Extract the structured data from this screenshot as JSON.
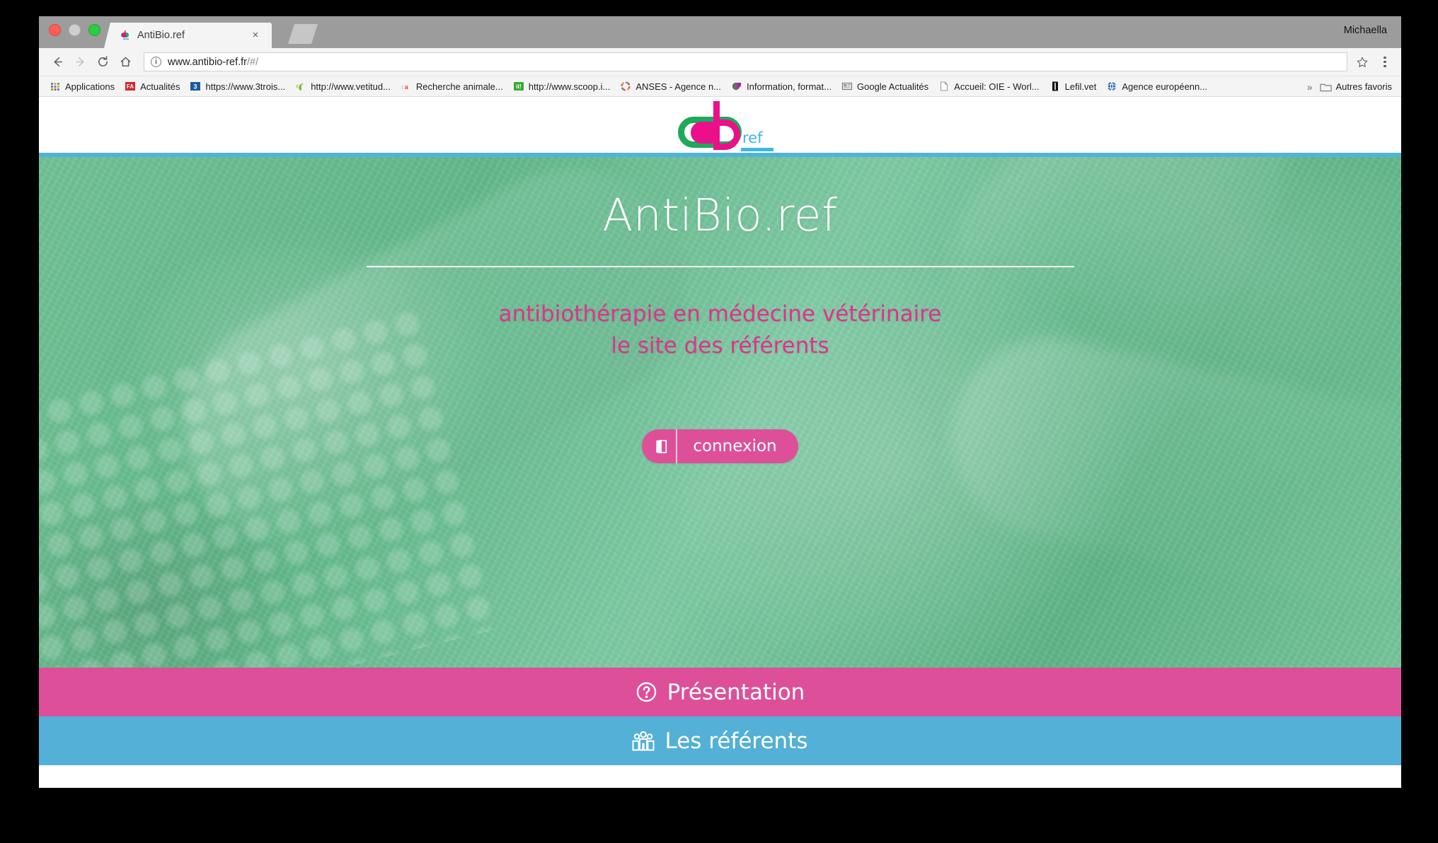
{
  "os": {
    "user_name": "Michaella"
  },
  "browser": {
    "tab": {
      "title": "AntiBio.ref",
      "close_label": "×"
    },
    "toolbar": {
      "back_label": "←",
      "forward_label": "→",
      "reload_label": "⟳",
      "home_label": "⌂",
      "info_label": "i",
      "url_main": "www.antibio-ref.fr",
      "url_path": "/#/",
      "star_label": "☆"
    },
    "bookmarks": {
      "items": [
        {
          "label": "Applications",
          "icon": "apps-grid-icon",
          "color": "#4a90d9"
        },
        {
          "label": "Actualités",
          "icon": "fa-icon",
          "color": "#d8232a"
        },
        {
          "label": "https://www.3trois...",
          "icon": "three-icon",
          "color": "#1b5c9b"
        },
        {
          "label": "http://www.vetitud...",
          "icon": "leaf-icon",
          "color": "#8cc63e"
        },
        {
          "label": "Recherche animale...",
          "icon": "ra-icon",
          "color": "#e8502a"
        },
        {
          "label": "http://www.scoop.i...",
          "icon": "scoopit-icon",
          "color": "#3aa935"
        },
        {
          "label": "ANSES - Agence n...",
          "icon": "anses-ring-icon",
          "color": "#e94e8a"
        },
        {
          "label": "Information, format...",
          "icon": "info-format-icon",
          "color": "#7a1fa2"
        },
        {
          "label": "Google Actualités",
          "icon": "news-icon",
          "color": "#7a7a7a"
        },
        {
          "label": "Accueil: OIE - Worl...",
          "icon": "page-icon",
          "color": "#9a9a9a"
        },
        {
          "label": "Lefil.vet",
          "icon": "lefil-icon",
          "color": "#111111"
        },
        {
          "label": "Agence européenn...",
          "icon": "globe-icon",
          "color": "#2d6fb5"
        }
      ],
      "overflow_label": "»",
      "other_bookmarks_label": "Autres favoris"
    }
  },
  "site": {
    "logo": {
      "ref_text": "ref",
      "green": "#1eaa5a",
      "pink": "#ec0f8c",
      "blue": "#3fb6e5"
    },
    "hero": {
      "title": "AntiBio.ref",
      "subtitle_line1": "antibiothérapie en médecine vétérinaire",
      "subtitle_line2": "le site des référents",
      "login_label": "connexion",
      "title_color": "#ffffff",
      "subtitle_color": "#e0338c",
      "button_color": "#dd5099"
    },
    "nav": [
      {
        "label": "Présentation",
        "icon": "question-circle-icon",
        "color": "#dd5099"
      },
      {
        "label": "Les référents",
        "icon": "people-group-icon",
        "color": "#53b0d6"
      }
    ]
  }
}
